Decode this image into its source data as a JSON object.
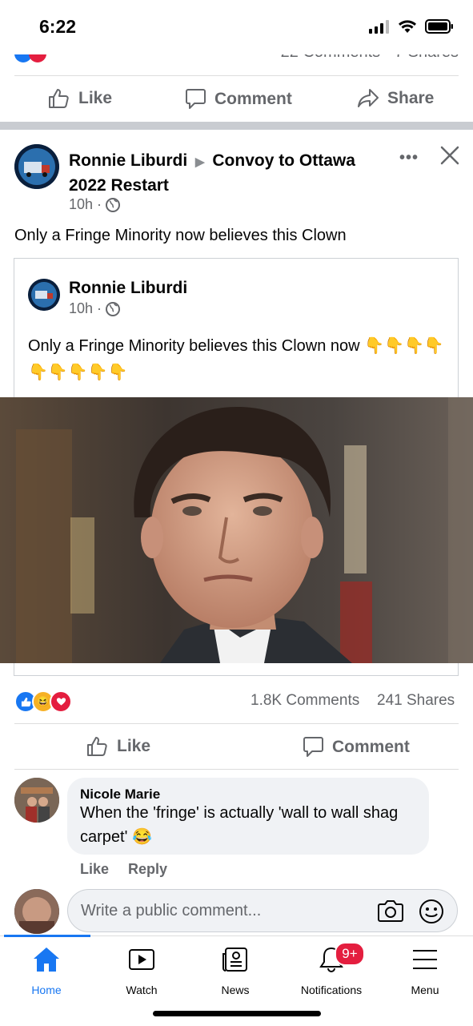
{
  "status": {
    "time": "6:22"
  },
  "prev_post": {
    "counts_partial": "22 Comments · 7 Shares"
  },
  "prev_actions": {
    "like": "Like",
    "comment": "Comment",
    "share": "Share"
  },
  "post": {
    "author": "Ronnie Liburdi",
    "group": "Convoy to Ottawa 2022 Restart",
    "time": "10h ·",
    "text": "Only a Fringe Minority now believes this Clown"
  },
  "shared": {
    "author": "Ronnie Liburdi",
    "time": "10h ·",
    "text": "Only a Fringe Minority believes this Clown now",
    "emojis": "👇👇👇👇👇👇👇👇👇"
  },
  "stats": {
    "comments": "1.8K Comments",
    "shares": "241 Shares"
  },
  "post_actions": {
    "like": "Like",
    "comment": "Comment"
  },
  "comment": {
    "author": "Nicole Marie",
    "text": "When the 'fringe' is actually 'wall to wall shag carpet' 😂",
    "like": "Like",
    "reply": "Reply"
  },
  "composer": {
    "placeholder": "Write a public comment..."
  },
  "nav": {
    "home": "Home",
    "watch": "Watch",
    "news": "News",
    "notifications": "Notifications",
    "notifications_badge": "9+",
    "menu": "Menu"
  },
  "colors": {
    "accent": "#1877f2",
    "badge": "#e41e3f",
    "muted": "#65676b"
  }
}
